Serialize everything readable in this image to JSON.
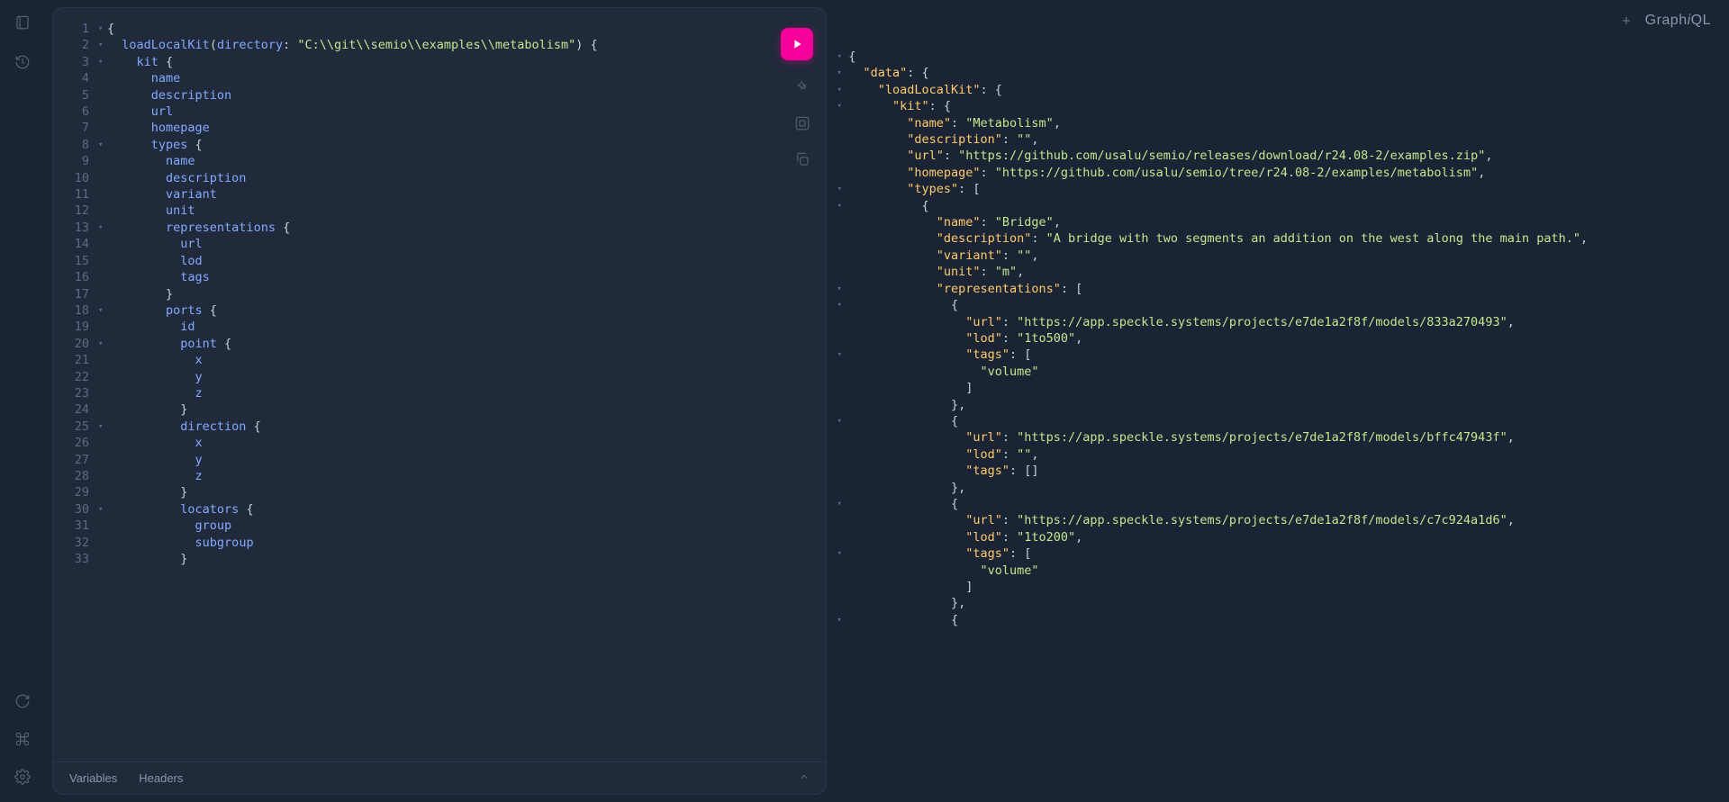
{
  "app": {
    "logo": "GraphiQL"
  },
  "tabs": {
    "variables": "Variables",
    "headers": "Headers"
  },
  "query": [
    {
      "n": 1,
      "fold": true,
      "tokens": [
        [
          "punct",
          "{"
        ]
      ]
    },
    {
      "n": 2,
      "fold": true,
      "tokens": [
        [
          "indent",
          1
        ],
        [
          "field",
          "loadLocalKit"
        ],
        [
          "punct",
          "("
        ],
        [
          "arg",
          "directory"
        ],
        [
          "punct",
          ": "
        ],
        [
          "str",
          "\"C:\\\\git\\\\semio\\\\examples\\\\metabolism\""
        ],
        [
          "punct",
          ") {"
        ]
      ]
    },
    {
      "n": 3,
      "fold": true,
      "tokens": [
        [
          "indent",
          2
        ],
        [
          "field",
          "kit"
        ],
        [
          "punct",
          " {"
        ]
      ]
    },
    {
      "n": 4,
      "fold": false,
      "tokens": [
        [
          "indent",
          3
        ],
        [
          "field",
          "name"
        ]
      ]
    },
    {
      "n": 5,
      "fold": false,
      "tokens": [
        [
          "indent",
          3
        ],
        [
          "field",
          "description"
        ]
      ]
    },
    {
      "n": 6,
      "fold": false,
      "tokens": [
        [
          "indent",
          3
        ],
        [
          "field",
          "url"
        ]
      ]
    },
    {
      "n": 7,
      "fold": false,
      "tokens": [
        [
          "indent",
          3
        ],
        [
          "field",
          "homepage"
        ]
      ]
    },
    {
      "n": 8,
      "fold": true,
      "tokens": [
        [
          "indent",
          3
        ],
        [
          "field",
          "types"
        ],
        [
          "punct",
          " {"
        ]
      ]
    },
    {
      "n": 9,
      "fold": false,
      "tokens": [
        [
          "indent",
          4
        ],
        [
          "field",
          "name"
        ]
      ]
    },
    {
      "n": 10,
      "fold": false,
      "tokens": [
        [
          "indent",
          4
        ],
        [
          "field",
          "description"
        ]
      ]
    },
    {
      "n": 11,
      "fold": false,
      "tokens": [
        [
          "indent",
          4
        ],
        [
          "field",
          "variant"
        ]
      ]
    },
    {
      "n": 12,
      "fold": false,
      "tokens": [
        [
          "indent",
          4
        ],
        [
          "field",
          "unit"
        ]
      ]
    },
    {
      "n": 13,
      "fold": true,
      "tokens": [
        [
          "indent",
          4
        ],
        [
          "field",
          "representations"
        ],
        [
          "punct",
          " {"
        ]
      ]
    },
    {
      "n": 14,
      "fold": false,
      "tokens": [
        [
          "indent",
          5
        ],
        [
          "field",
          "url"
        ]
      ]
    },
    {
      "n": 15,
      "fold": false,
      "tokens": [
        [
          "indent",
          5
        ],
        [
          "field",
          "lod"
        ]
      ]
    },
    {
      "n": 16,
      "fold": false,
      "tokens": [
        [
          "indent",
          5
        ],
        [
          "field",
          "tags"
        ]
      ]
    },
    {
      "n": 17,
      "fold": false,
      "tokens": [
        [
          "indent",
          4
        ],
        [
          "punct",
          "}"
        ]
      ]
    },
    {
      "n": 18,
      "fold": true,
      "tokens": [
        [
          "indent",
          4
        ],
        [
          "field",
          "ports"
        ],
        [
          "punct",
          " {"
        ]
      ]
    },
    {
      "n": 19,
      "fold": false,
      "tokens": [
        [
          "indent",
          5
        ],
        [
          "field",
          "id"
        ]
      ]
    },
    {
      "n": 20,
      "fold": true,
      "tokens": [
        [
          "indent",
          5
        ],
        [
          "field",
          "point"
        ],
        [
          "punct",
          " {"
        ]
      ]
    },
    {
      "n": 21,
      "fold": false,
      "tokens": [
        [
          "indent",
          6
        ],
        [
          "field",
          "x"
        ]
      ]
    },
    {
      "n": 22,
      "fold": false,
      "tokens": [
        [
          "indent",
          6
        ],
        [
          "field",
          "y"
        ]
      ]
    },
    {
      "n": 23,
      "fold": false,
      "tokens": [
        [
          "indent",
          6
        ],
        [
          "field",
          "z"
        ]
      ]
    },
    {
      "n": 24,
      "fold": false,
      "tokens": [
        [
          "indent",
          5
        ],
        [
          "punct",
          "}"
        ]
      ]
    },
    {
      "n": 25,
      "fold": true,
      "tokens": [
        [
          "indent",
          5
        ],
        [
          "field",
          "direction"
        ],
        [
          "punct",
          " {"
        ]
      ]
    },
    {
      "n": 26,
      "fold": false,
      "tokens": [
        [
          "indent",
          6
        ],
        [
          "field",
          "x"
        ]
      ]
    },
    {
      "n": 27,
      "fold": false,
      "tokens": [
        [
          "indent",
          6
        ],
        [
          "field",
          "y"
        ]
      ]
    },
    {
      "n": 28,
      "fold": false,
      "tokens": [
        [
          "indent",
          6
        ],
        [
          "field",
          "z"
        ]
      ]
    },
    {
      "n": 29,
      "fold": false,
      "tokens": [
        [
          "indent",
          5
        ],
        [
          "punct",
          "}"
        ]
      ]
    },
    {
      "n": 30,
      "fold": true,
      "tokens": [
        [
          "indent",
          5
        ],
        [
          "field",
          "locators"
        ],
        [
          "punct",
          " {"
        ]
      ]
    },
    {
      "n": 31,
      "fold": false,
      "tokens": [
        [
          "indent",
          6
        ],
        [
          "field",
          "group"
        ]
      ]
    },
    {
      "n": 32,
      "fold": false,
      "tokens": [
        [
          "indent",
          6
        ],
        [
          "field",
          "subgroup"
        ]
      ]
    },
    {
      "n": 33,
      "fold": false,
      "tokens": [
        [
          "indent",
          5
        ],
        [
          "punct",
          "}"
        ]
      ]
    }
  ],
  "response": [
    {
      "fold": true,
      "indent": 0,
      "parts": [
        [
          "brace",
          "{"
        ]
      ]
    },
    {
      "fold": true,
      "indent": 1,
      "parts": [
        [
          "key",
          "\"data\""
        ],
        [
          "punct",
          ": "
        ],
        [
          "brace",
          "{"
        ]
      ]
    },
    {
      "fold": true,
      "indent": 2,
      "parts": [
        [
          "key",
          "\"loadLocalKit\""
        ],
        [
          "punct",
          ": "
        ],
        [
          "brace",
          "{"
        ]
      ]
    },
    {
      "fold": true,
      "indent": 3,
      "parts": [
        [
          "key",
          "\"kit\""
        ],
        [
          "punct",
          ": "
        ],
        [
          "brace",
          "{"
        ]
      ]
    },
    {
      "fold": false,
      "indent": 4,
      "parts": [
        [
          "key",
          "\"name\""
        ],
        [
          "punct",
          ": "
        ],
        [
          "str",
          "\"Metabolism\""
        ],
        [
          "punct",
          ","
        ]
      ]
    },
    {
      "fold": false,
      "indent": 4,
      "parts": [
        [
          "key",
          "\"description\""
        ],
        [
          "punct",
          ": "
        ],
        [
          "str",
          "\"\""
        ],
        [
          "punct",
          ","
        ]
      ]
    },
    {
      "fold": false,
      "indent": 4,
      "parts": [
        [
          "key",
          "\"url\""
        ],
        [
          "punct",
          ": "
        ],
        [
          "str",
          "\"https://github.com/usalu/semio/releases/download/r24.08-2/examples.zip\""
        ],
        [
          "punct",
          ","
        ]
      ]
    },
    {
      "fold": false,
      "indent": 4,
      "parts": [
        [
          "key",
          "\"homepage\""
        ],
        [
          "punct",
          ": "
        ],
        [
          "str",
          "\"https://github.com/usalu/semio/tree/r24.08-2/examples/metabolism\""
        ],
        [
          "punct",
          ","
        ]
      ]
    },
    {
      "fold": true,
      "indent": 4,
      "parts": [
        [
          "key",
          "\"types\""
        ],
        [
          "punct",
          ": ["
        ]
      ]
    },
    {
      "fold": true,
      "indent": 5,
      "parts": [
        [
          "brace",
          "{"
        ]
      ]
    },
    {
      "fold": false,
      "indent": 6,
      "parts": [
        [
          "key",
          "\"name\""
        ],
        [
          "punct",
          ": "
        ],
        [
          "str",
          "\"Bridge\""
        ],
        [
          "punct",
          ","
        ]
      ]
    },
    {
      "fold": false,
      "indent": 6,
      "parts": [
        [
          "key",
          "\"description\""
        ],
        [
          "punct",
          ": "
        ],
        [
          "str",
          "\"A bridge with two segments an addition on the west along the main path.\""
        ],
        [
          "punct",
          ","
        ]
      ]
    },
    {
      "fold": false,
      "indent": 6,
      "parts": [
        [
          "key",
          "\"variant\""
        ],
        [
          "punct",
          ": "
        ],
        [
          "str",
          "\"\""
        ],
        [
          "punct",
          ","
        ]
      ]
    },
    {
      "fold": false,
      "indent": 6,
      "parts": [
        [
          "key",
          "\"unit\""
        ],
        [
          "punct",
          ": "
        ],
        [
          "str",
          "\"m\""
        ],
        [
          "punct",
          ","
        ]
      ]
    },
    {
      "fold": true,
      "indent": 6,
      "parts": [
        [
          "key",
          "\"representations\""
        ],
        [
          "punct",
          ": ["
        ]
      ]
    },
    {
      "fold": true,
      "indent": 7,
      "parts": [
        [
          "brace",
          "{"
        ]
      ]
    },
    {
      "fold": false,
      "indent": 8,
      "parts": [
        [
          "key",
          "\"url\""
        ],
        [
          "punct",
          ": "
        ],
        [
          "str",
          "\"https://app.speckle.systems/projects/e7de1a2f8f/models/833a270493\""
        ],
        [
          "punct",
          ","
        ]
      ]
    },
    {
      "fold": false,
      "indent": 8,
      "parts": [
        [
          "key",
          "\"lod\""
        ],
        [
          "punct",
          ": "
        ],
        [
          "str",
          "\"1to500\""
        ],
        [
          "punct",
          ","
        ]
      ]
    },
    {
      "fold": true,
      "indent": 8,
      "parts": [
        [
          "key",
          "\"tags\""
        ],
        [
          "punct",
          ": ["
        ]
      ]
    },
    {
      "fold": false,
      "indent": 9,
      "parts": [
        [
          "str",
          "\"volume\""
        ]
      ]
    },
    {
      "fold": false,
      "indent": 8,
      "parts": [
        [
          "punct",
          "]"
        ]
      ]
    },
    {
      "fold": false,
      "indent": 7,
      "parts": [
        [
          "brace",
          "}"
        ],
        [
          "punct",
          ","
        ]
      ]
    },
    {
      "fold": true,
      "indent": 7,
      "parts": [
        [
          "brace",
          "{"
        ]
      ]
    },
    {
      "fold": false,
      "indent": 8,
      "parts": [
        [
          "key",
          "\"url\""
        ],
        [
          "punct",
          ": "
        ],
        [
          "str",
          "\"https://app.speckle.systems/projects/e7de1a2f8f/models/bffc47943f\""
        ],
        [
          "punct",
          ","
        ]
      ]
    },
    {
      "fold": false,
      "indent": 8,
      "parts": [
        [
          "key",
          "\"lod\""
        ],
        [
          "punct",
          ": "
        ],
        [
          "str",
          "\"\""
        ],
        [
          "punct",
          ","
        ]
      ]
    },
    {
      "fold": false,
      "indent": 8,
      "parts": [
        [
          "key",
          "\"tags\""
        ],
        [
          "punct",
          ": []"
        ]
      ]
    },
    {
      "fold": false,
      "indent": 7,
      "parts": [
        [
          "brace",
          "}"
        ],
        [
          "punct",
          ","
        ]
      ]
    },
    {
      "fold": true,
      "indent": 7,
      "parts": [
        [
          "brace",
          "{"
        ]
      ]
    },
    {
      "fold": false,
      "indent": 8,
      "parts": [
        [
          "key",
          "\"url\""
        ],
        [
          "punct",
          ": "
        ],
        [
          "str",
          "\"https://app.speckle.systems/projects/e7de1a2f8f/models/c7c924a1d6\""
        ],
        [
          "punct",
          ","
        ]
      ]
    },
    {
      "fold": false,
      "indent": 8,
      "parts": [
        [
          "key",
          "\"lod\""
        ],
        [
          "punct",
          ": "
        ],
        [
          "str",
          "\"1to200\""
        ],
        [
          "punct",
          ","
        ]
      ]
    },
    {
      "fold": true,
      "indent": 8,
      "parts": [
        [
          "key",
          "\"tags\""
        ],
        [
          "punct",
          ": ["
        ]
      ]
    },
    {
      "fold": false,
      "indent": 9,
      "parts": [
        [
          "str",
          "\"volume\""
        ]
      ]
    },
    {
      "fold": false,
      "indent": 8,
      "parts": [
        [
          "punct",
          "]"
        ]
      ]
    },
    {
      "fold": false,
      "indent": 7,
      "parts": [
        [
          "brace",
          "}"
        ],
        [
          "punct",
          ","
        ]
      ]
    },
    {
      "fold": true,
      "indent": 7,
      "parts": [
        [
          "brace",
          "{"
        ]
      ]
    }
  ]
}
